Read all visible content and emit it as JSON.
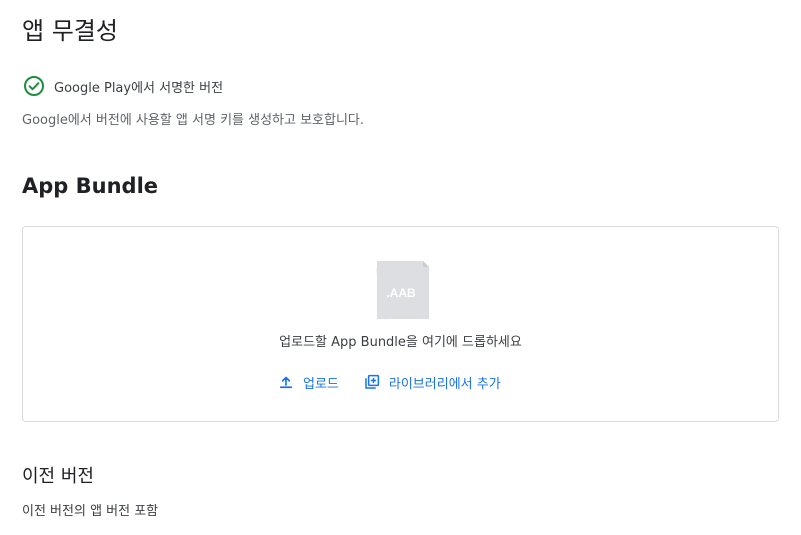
{
  "app_integrity": {
    "title": "앱 무결성",
    "signing": {
      "status_label": "Google Play에서 서명한 버전",
      "description": "Google에서 버전에 사용할 앱 서명 키를 생성하고 보호합니다."
    }
  },
  "app_bundle": {
    "title": "App Bundle",
    "dropzone": {
      "file_type_label": ".AAB",
      "hint": "업로드할 App Bundle을 여기에 드롭하세요",
      "upload_label": "업로드",
      "library_label": "라이브러리에서 추가"
    }
  },
  "previous_versions": {
    "title": "이전 버전",
    "description": "이전 버전의 앱 버전 포함"
  },
  "colors": {
    "accent": "#1a73e8",
    "success": "#1e8e3e",
    "border": "#dadce0"
  },
  "icons": {
    "signing_status": "check-circle-icon",
    "upload": "upload-icon",
    "library": "library-add-icon",
    "file": "aab-file-icon"
  }
}
